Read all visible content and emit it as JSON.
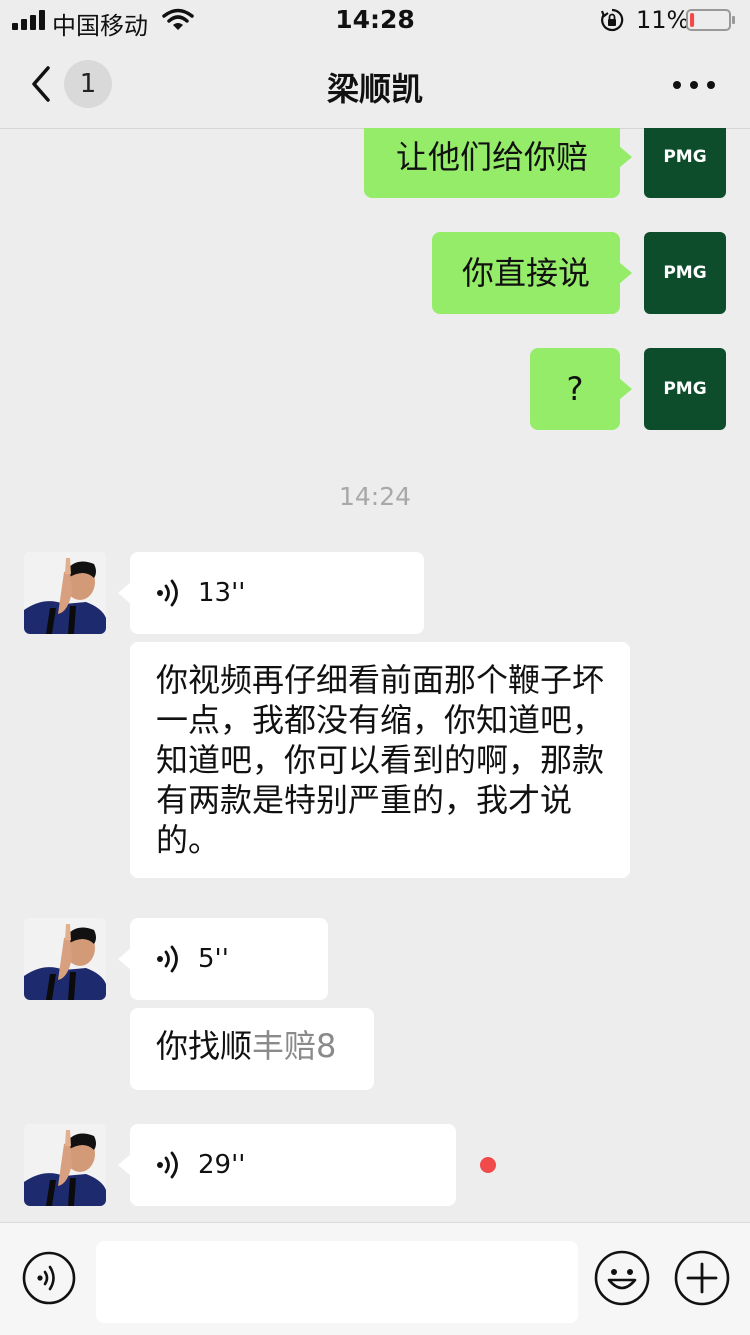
{
  "status_bar": {
    "carrier": "中国移动",
    "time": "14:28",
    "battery_percent": "11%",
    "battery_level": 0.11,
    "icons": [
      "signal-icon",
      "wifi-icon",
      "rotation-lock-icon",
      "battery-icon"
    ]
  },
  "nav": {
    "back_icon": "chevron-left-icon",
    "unread_count": "1",
    "title": "梁顺凯",
    "more_icon": "more-dots-icon"
  },
  "my_avatar_text": "PMG",
  "messages": [
    {
      "from": "me",
      "type": "text",
      "text": "让他们给你赔"
    },
    {
      "from": "me",
      "type": "text",
      "text": "你直接说"
    },
    {
      "from": "me",
      "type": "text",
      "text": "?"
    },
    {
      "type": "timestamp",
      "text": "14:24"
    },
    {
      "from": "them",
      "type": "voice",
      "duration": "13''"
    },
    {
      "from": "them",
      "type": "text",
      "text": "你视频再仔细看前面那个鞭子坏一点，我都没有缩，你知道吧，知道吧，你可以看到的啊，那款有两款是特别严重的，我才说的。"
    },
    {
      "from": "them",
      "type": "voice",
      "duration": "5''"
    },
    {
      "from": "them",
      "type": "text",
      "text": "你找顺",
      "text_faded": "丰赔8"
    },
    {
      "from": "them",
      "type": "voice",
      "duration": "29''",
      "unread": true
    }
  ],
  "input_bar": {
    "voice_icon": "voice-mode-icon",
    "message_placeholder": "",
    "emoji_icon": "emoji-icon",
    "plus_icon": "plus-icon"
  },
  "colors": {
    "background": "#ededed",
    "my_bubble": "#95ec69",
    "their_bubble": "#ffffff",
    "my_avatar": "#0e4d2c",
    "unread_dot": "#f04a4a",
    "battery_low": "#f04a4a"
  }
}
